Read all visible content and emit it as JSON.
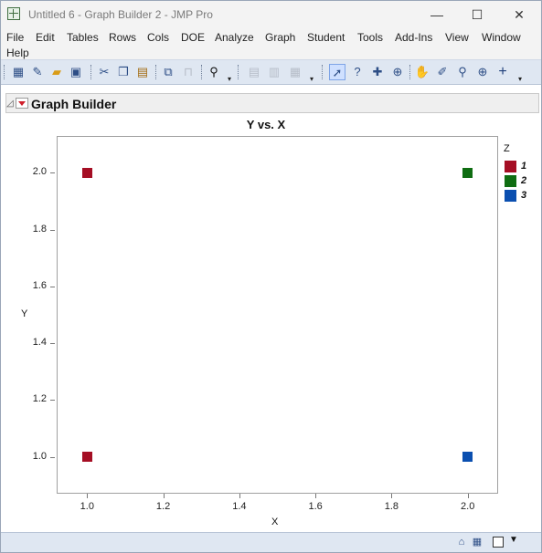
{
  "window": {
    "title": "Untitled 6 - Graph Builder 2 - JMP Pro",
    "minimize_glyph": "—",
    "maximize_glyph": "☐",
    "close_glyph": "✕"
  },
  "menu": {
    "items": [
      "File",
      "Edit",
      "Tables",
      "Rows",
      "Cols",
      "DOE",
      "Analyze",
      "Graph",
      "Student",
      "Tools",
      "Add-Ins",
      "View",
      "Window",
      "Help"
    ]
  },
  "toolbar": {
    "icons": [
      "new-data-table-icon",
      "new-script-icon",
      "open-icon",
      "save-icon",
      "cut-icon",
      "copy-icon",
      "paste-icon",
      "embed-icon",
      "lock-icon",
      "search-icon",
      "table-view-icon",
      "column-icon",
      "add-rows-icon",
      "arrow-tool-icon",
      "help-tool-icon",
      "brush-icon",
      "crosshair-icon",
      "hand-icon",
      "lasso-icon",
      "zoom-icon",
      "magnifier-icon",
      "plus-icon"
    ]
  },
  "report": {
    "outline_title": "Graph Builder",
    "collapse_glyph": "◿"
  },
  "chart_data": {
    "type": "scatter",
    "title": "Y vs. X",
    "xlabel": "X",
    "ylabel": "Y",
    "xlim": [
      0.92,
      2.08
    ],
    "ylim": [
      0.87,
      2.13
    ],
    "xticks": [
      "1.0",
      "1.2",
      "1.4",
      "1.6",
      "1.8",
      "2.0"
    ],
    "yticks": [
      "1.0",
      "1.2",
      "1.4",
      "1.6",
      "1.8",
      "2.0"
    ],
    "grid": false,
    "legend": {
      "title": "Z",
      "placement": "right",
      "entries": [
        {
          "name": "1",
          "color": "#a50e24"
        },
        {
          "name": "2",
          "color": "#0f6d12"
        },
        {
          "name": "3",
          "color": "#0b4fb0"
        }
      ]
    },
    "series": [
      {
        "name": "1",
        "color": "#a50e24",
        "points": [
          {
            "x": 1.0,
            "y": 2.0
          },
          {
            "x": 1.0,
            "y": 1.0
          }
        ]
      },
      {
        "name": "2",
        "color": "#0f6d12",
        "points": [
          {
            "x": 2.0,
            "y": 2.0
          }
        ]
      },
      {
        "name": "3",
        "color": "#0b4fb0",
        "points": [
          {
            "x": 2.0,
            "y": 1.0
          }
        ]
      }
    ]
  },
  "statusbar": {
    "icons": [
      "home-icon",
      "table-icon",
      "checkbox-icon",
      "dropdown-arrow-icon"
    ],
    "drop_glyph": "▼"
  }
}
